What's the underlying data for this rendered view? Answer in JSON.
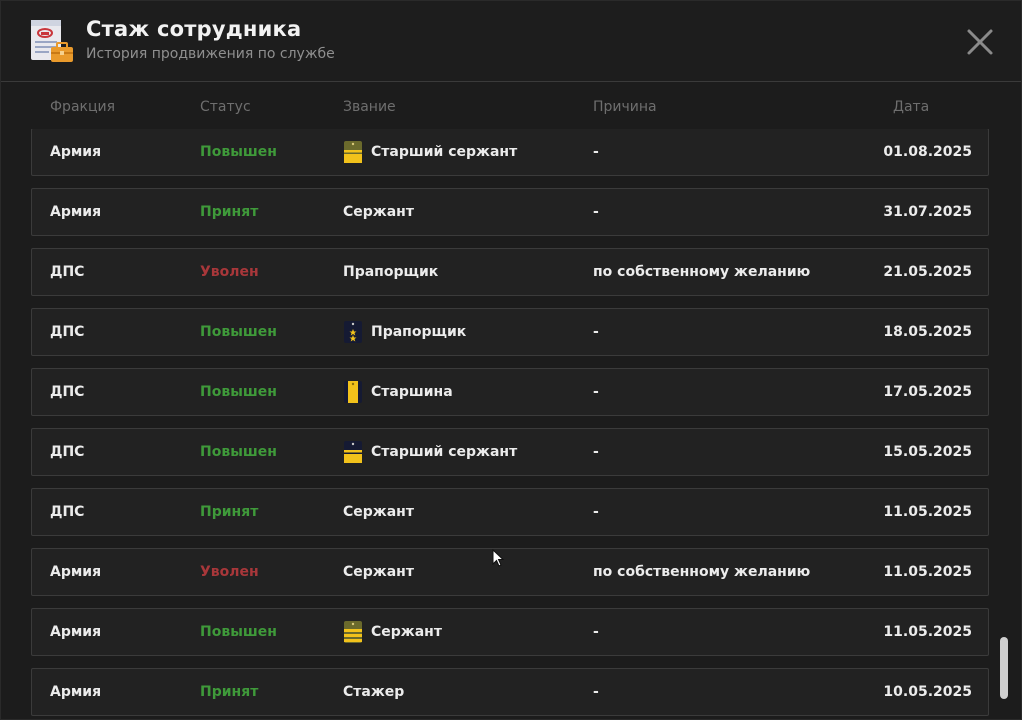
{
  "header": {
    "title": "Стаж сотрудника",
    "subtitle": "История продвижения по службе"
  },
  "columns": {
    "faction": "Фракция",
    "status": "Статус",
    "rank": "Звание",
    "reason": "Причина",
    "date": "Дата"
  },
  "colors": {
    "promoted": "#3f9a3a",
    "hired": "#3f9a3a",
    "fired": "#a8373a",
    "rank_gold": "#f2c21b",
    "rank_army_base": "#6b6a2c",
    "rank_dps_base": "#151a33"
  },
  "rows": [
    {
      "faction": "Армия",
      "status": "Повышен",
      "status_type": "up",
      "rank": "Старший сержант",
      "rank_icon": "army-senior-sergeant-icon",
      "reason": "-",
      "date": "01.08.2025"
    },
    {
      "faction": "Армия",
      "status": "Принят",
      "status_type": "in",
      "rank": "Сержант",
      "rank_icon": "",
      "reason": "-",
      "date": "31.07.2025"
    },
    {
      "faction": "ДПС",
      "status": "Уволен",
      "status_type": "out",
      "rank": "Прапорщик",
      "rank_icon": "",
      "reason": "по собственному желанию",
      "date": "21.05.2025"
    },
    {
      "faction": "ДПС",
      "status": "Повышен",
      "status_type": "up",
      "rank": "Прапорщик",
      "rank_icon": "dps-warrant-officer-icon",
      "reason": "-",
      "date": "18.05.2025"
    },
    {
      "faction": "ДПС",
      "status": "Повышен",
      "status_type": "up",
      "rank": "Старшина",
      "rank_icon": "dps-sergeant-major-icon",
      "reason": "-",
      "date": "17.05.2025"
    },
    {
      "faction": "ДПС",
      "status": "Повышен",
      "status_type": "up",
      "rank": "Старший сержант",
      "rank_icon": "dps-senior-sergeant-icon",
      "reason": "-",
      "date": "15.05.2025"
    },
    {
      "faction": "ДПС",
      "status": "Принят",
      "status_type": "in",
      "rank": "Сержант",
      "rank_icon": "",
      "reason": "-",
      "date": "11.05.2025"
    },
    {
      "faction": "Армия",
      "status": "Уволен",
      "status_type": "out",
      "rank": "Сержант",
      "rank_icon": "",
      "reason": "по собственному желанию",
      "date": "11.05.2025"
    },
    {
      "faction": "Армия",
      "status": "Повышен",
      "status_type": "up",
      "rank": "Сержант",
      "rank_icon": "army-sergeant-icon",
      "reason": "-",
      "date": "11.05.2025"
    },
    {
      "faction": "Армия",
      "status": "Принят",
      "status_type": "in",
      "rank": "Стажер",
      "rank_icon": "",
      "reason": "-",
      "date": "10.05.2025"
    }
  ]
}
